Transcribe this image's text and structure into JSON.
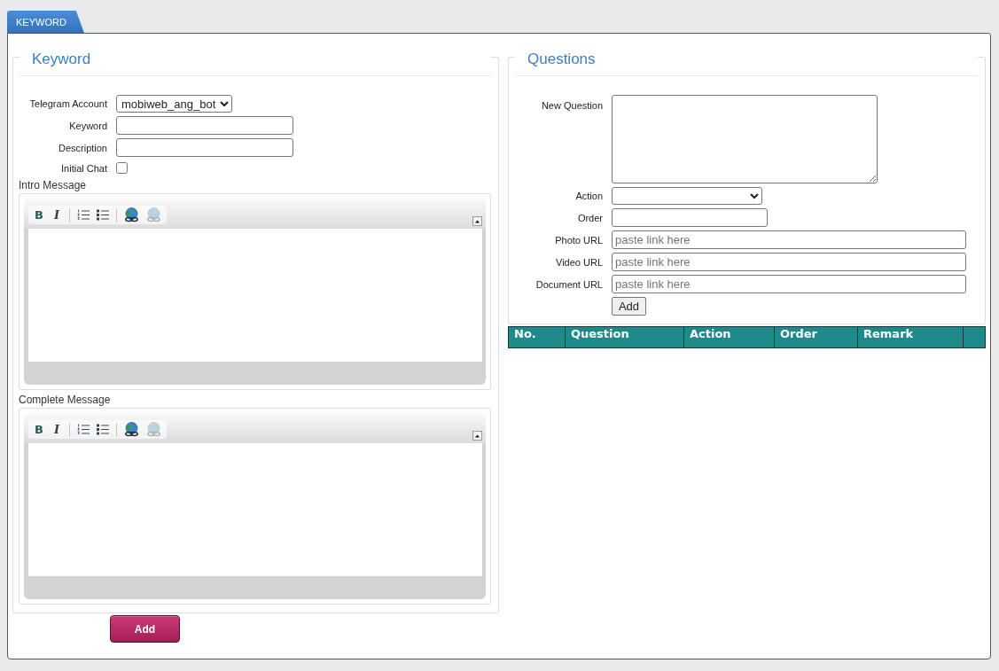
{
  "tab": {
    "label": "KEYWORD",
    "selected": true
  },
  "keyword_panel": {
    "title": "Keyword",
    "fields": [
      {
        "kind": "select",
        "label": "Telegram Account",
        "value": "mobiweb_ang_bot"
      },
      {
        "kind": "text",
        "label": "Keyword"
      },
      {
        "kind": "text",
        "label": "Description"
      },
      {
        "kind": "checkbox",
        "label": "Initial Chat",
        "checked": false
      }
    ],
    "editors": [
      {
        "label": "Intro Message",
        "toolbar": [
          {
            "kind": "bold",
            "label": "B",
            "disabled": false
          },
          {
            "kind": "italic",
            "label": "I",
            "disabled": false
          },
          {
            "kind": "numbered-list",
            "disabled": false
          },
          {
            "kind": "bullet-list",
            "disabled": false
          },
          {
            "kind": "link",
            "disabled": false
          },
          {
            "kind": "unlink",
            "disabled": true
          }
        ]
      },
      {
        "label": "Complete Message",
        "toolbar": [
          {
            "kind": "bold",
            "label": "B",
            "disabled": false
          },
          {
            "kind": "italic",
            "label": "I",
            "disabled": false
          },
          {
            "kind": "numbered-list",
            "disabled": false
          },
          {
            "kind": "bullet-list",
            "disabled": false
          },
          {
            "kind": "link",
            "disabled": false
          },
          {
            "kind": "unlink",
            "disabled": true
          }
        ]
      }
    ]
  },
  "add_button": {
    "label": "Add"
  },
  "questions_panel": {
    "title": "Questions",
    "fields": [
      {
        "kind": "textarea",
        "label": "New Question"
      },
      {
        "kind": "select",
        "label": "Action"
      },
      {
        "kind": "text",
        "label": "Order"
      },
      {
        "kind": "url",
        "label": "Photo URL",
        "placeholder": "paste link here"
      },
      {
        "kind": "url",
        "label": "Video URL",
        "placeholder": "paste link here"
      },
      {
        "kind": "url",
        "label": "Document URL",
        "placeholder": "paste link here"
      }
    ],
    "add_button": {
      "label": "Add"
    }
  },
  "table": {
    "columns": [
      "No.",
      "Question",
      "Action",
      "Order",
      "Remark"
    ]
  }
}
